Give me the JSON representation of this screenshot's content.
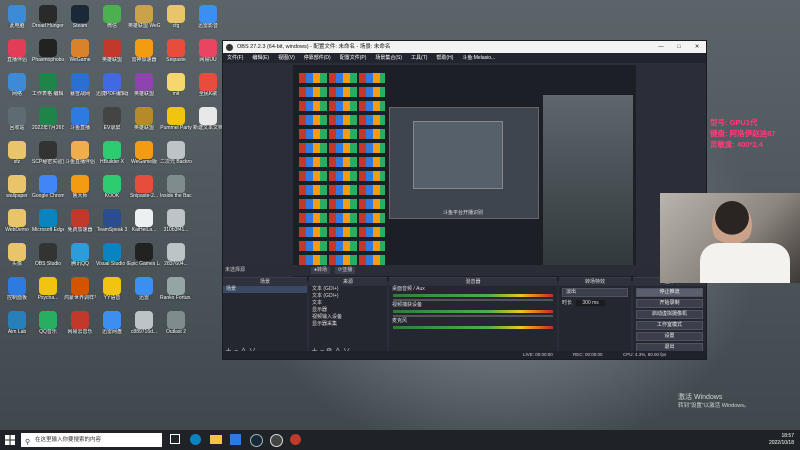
{
  "desktop": {
    "icons": [
      {
        "name": "此电脑",
        "color": "#3d8bd6"
      },
      {
        "name": "Dread Hunger",
        "color": "#2a2a2a"
      },
      {
        "name": "Steam",
        "color": "#1b2838"
      },
      {
        "name": "微信",
        "color": "#4caf50"
      },
      {
        "name": "英雄联盟 WeGame",
        "color": "#c9a24a"
      },
      {
        "name": "cfg",
        "color": "#e8c56a"
      },
      {
        "name": "迅雷影音",
        "color": "#3b8ff0"
      },
      {
        "name": "直播伴侣",
        "color": "#e23c57"
      },
      {
        "name": "Phasmophobia",
        "color": "#222"
      },
      {
        "name": "WeGame",
        "color": "#d9822b"
      },
      {
        "name": "英雄联盟",
        "color": "#c0392b"
      },
      {
        "name": "雷神加速器",
        "color": "#f39c12"
      },
      {
        "name": "Snipaste",
        "color": "#e74c3c"
      },
      {
        "name": "网易UU",
        "color": "#e94560"
      },
      {
        "name": "网络",
        "color": "#3d8bd6"
      },
      {
        "name": "工作表格 编辑.xlsx",
        "color": "#1e8449"
      },
      {
        "name": "暴雪战网",
        "color": "#2a6fd1"
      },
      {
        "name": "迅捷PDF编辑器",
        "color": "#4169e1"
      },
      {
        "name": "英雄联盟",
        "color": "#8e44ad"
      },
      {
        "name": "mit",
        "color": "#f5d76e"
      },
      {
        "name": "全民K歌",
        "color": "#e74c3c"
      },
      {
        "name": "回收站",
        "color": "#5f6b73"
      },
      {
        "name": "2022年7月26日.xlsx",
        "color": "#1e8449"
      },
      {
        "name": "斗鱼直播",
        "color": "#2d7be0"
      },
      {
        "name": "EV录屏",
        "color": "#444"
      },
      {
        "name": "英雄联盟",
        "color": "#b58b2a"
      },
      {
        "name": "Pummel Party",
        "color": "#f1c40f"
      },
      {
        "name": "新建文本文档",
        "color": "#e8e8e8"
      },
      {
        "name": "sfz",
        "color": "#e8c56a"
      },
      {
        "name": "SCP秘密实验室",
        "color": "#333"
      },
      {
        "name": "斗鱼直播伴侣",
        "color": "#f0ad4e"
      },
      {
        "name": "HBuilder X",
        "color": "#2ecc71"
      },
      {
        "name": "WeGame版",
        "color": "#f39c12"
      },
      {
        "name": "二次元 Backrooms",
        "color": "#bdc3c7"
      },
      {
        "name": "wallpaper",
        "color": "#e8c56a"
      },
      {
        "name": "Google Chrome",
        "color": "#4285f4"
      },
      {
        "name": "鲁大师",
        "color": "#f39c12"
      },
      {
        "name": "KOOK",
        "color": "#2ecc71"
      },
      {
        "name": "Snipaste-2...",
        "color": "#e74c3c"
      },
      {
        "name": "Inside the Backrooms",
        "color": "#7f8c8d"
      },
      {
        "name": "WebDemo",
        "color": "#e8c56a"
      },
      {
        "name": "Microsoft Edge",
        "color": "#0a84c1"
      },
      {
        "name": "免费加速器",
        "color": "#c0392b"
      },
      {
        "name": "TeamSpeak 3",
        "color": "#2a4d8f"
      },
      {
        "name": "KaiHeiLa...",
        "color": "#ecf0f1"
      },
      {
        "name": "310b3f41...",
        "color": "#bdc3c7"
      },
      {
        "name": "头像",
        "color": "#e8c56a"
      },
      {
        "name": "OBS Studio",
        "color": "#333"
      },
      {
        "name": "腾讯QQ",
        "color": "#2d9cdb"
      },
      {
        "name": "Visual Studio Code",
        "color": "#0a84c1"
      },
      {
        "name": "Epic Games Launcher",
        "color": "#222"
      },
      {
        "name": "2837604...",
        "color": "#bdc3c7"
      },
      {
        "name": "控制面板",
        "color": "#2d7be0"
      },
      {
        "name": "Psycha...",
        "color": "#f1c40f"
      },
      {
        "name": "鸿蒙世界调样平台",
        "color": "#d35400"
      },
      {
        "name": "YY语音",
        "color": "#f1c40f"
      },
      {
        "name": "迅雷",
        "color": "#3b8ff0"
      },
      {
        "name": "Ranko Fortun...",
        "color": "#95a5a6"
      },
      {
        "name": "Aim Lab",
        "color": "#2980b9"
      },
      {
        "name": "QQ音乐",
        "color": "#27ae60"
      },
      {
        "name": "网易云音乐",
        "color": "#c0392b"
      },
      {
        "name": "迅雷网盘",
        "color": "#3b8ff0"
      },
      {
        "name": "c889716d...",
        "color": "#bdc3c7"
      },
      {
        "name": "Outlast 2",
        "color": "#7f8c8d"
      }
    ]
  },
  "obs": {
    "title": "OBS 27.2.3 (64-bit, windows) - 配置文件: 未命名 - 场景: 未命名",
    "menu": [
      "文件(F)",
      "编辑(E)",
      "视图(V)",
      "停靠部件(D)",
      "配置文件(P)",
      "场景集合(S)",
      "工具(T)",
      "帮助(H)",
      "斗鱼:Melasio..."
    ],
    "preview_caption": "斗鱼平台开播识别",
    "scene_toolbar": [
      "●转场",
      "⟳亚播"
    ],
    "docks": {
      "scenes": {
        "title": "场景",
        "items": [
          "场景"
        ]
      },
      "sources": {
        "title": "来源",
        "items": [
          "文本 (GDI+)",
          "文本 (GDI+)",
          "文本",
          "显示器",
          "视频输入设备",
          "显示器采集"
        ]
      },
      "mixer": {
        "title": "混音器",
        "tracks": [
          {
            "name": "桌面音频 / Aux",
            "level": "0.0 dB"
          },
          {
            "name": "视频捕获设备",
            "level": "0.0 dB"
          },
          {
            "name": "麦克风",
            "level": "0.0 dB"
          }
        ]
      },
      "transitions": {
        "title": "转场特效",
        "value": "淡出",
        "duration_label": "时长",
        "duration": "300 ms"
      },
      "controls": {
        "title": "控件",
        "buttons": [
          "停止推流",
          "开始录制",
          "启动虚拟摄像机",
          "工作室模式",
          "设置",
          "退出"
        ]
      }
    },
    "status": {
      "live": "LIVE: 00:00:00",
      "rec": "REC: 00:00:00",
      "cpu": "CPU: 4.3%, 60.00 fps"
    }
  },
  "overlay_lines": [
    "型号: GPU1代",
    "键盘: 阿洛伊赵迪87",
    "灵敏度: 400*2.4"
  ],
  "activate_windows": {
    "line1": "激活 Windows",
    "line2": "转到“设置”以激活 Windows。"
  },
  "taskbar": {
    "search_placeholder": "在这里输入你要搜索的内容",
    "time": "18:57",
    "date": "2022/10/18"
  }
}
